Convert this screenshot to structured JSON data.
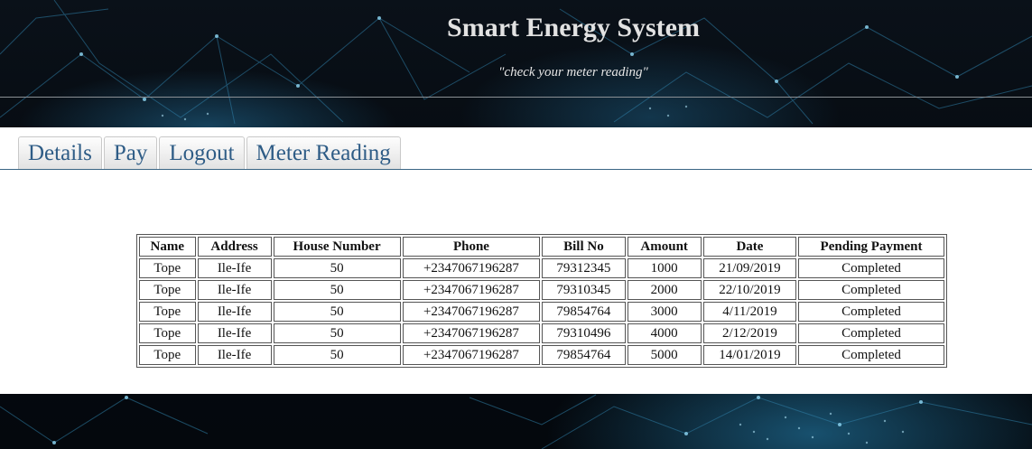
{
  "header": {
    "title": "Smart Energy System",
    "subtitle": "\"check your meter reading\""
  },
  "tabs": [
    {
      "label": "Details"
    },
    {
      "label": "Pay"
    },
    {
      "label": "Logout"
    },
    {
      "label": "Meter Reading"
    }
  ],
  "table": {
    "columns": [
      "Name",
      "Address",
      "House Number",
      "Phone",
      "Bill No",
      "Amount",
      "Date",
      "Pending Payment"
    ],
    "rows": [
      [
        "Tope",
        "Ile-Ife",
        "50",
        "+2347067196287",
        "79312345",
        "1000",
        "21/09/2019",
        "Completed"
      ],
      [
        "Tope",
        "Ile-Ife",
        "50",
        "+2347067196287",
        "79310345",
        "2000",
        "22/10/2019",
        "Completed"
      ],
      [
        "Tope",
        "Ile-Ife",
        "50",
        "+2347067196287",
        "79854764",
        "3000",
        "4/11/2019",
        "Completed"
      ],
      [
        "Tope",
        "Ile-Ife",
        "50",
        "+2347067196287",
        "79310496",
        "4000",
        "2/12/2019",
        "Completed"
      ],
      [
        "Tope",
        "Ile-Ife",
        "50",
        "+2347067196287",
        "79854764",
        "5000",
        "14/01/2019",
        "Completed"
      ]
    ]
  },
  "colors": {
    "tab_text": "#2e5c86",
    "background": "#050a10",
    "network_lines": "#3a8fb8"
  }
}
